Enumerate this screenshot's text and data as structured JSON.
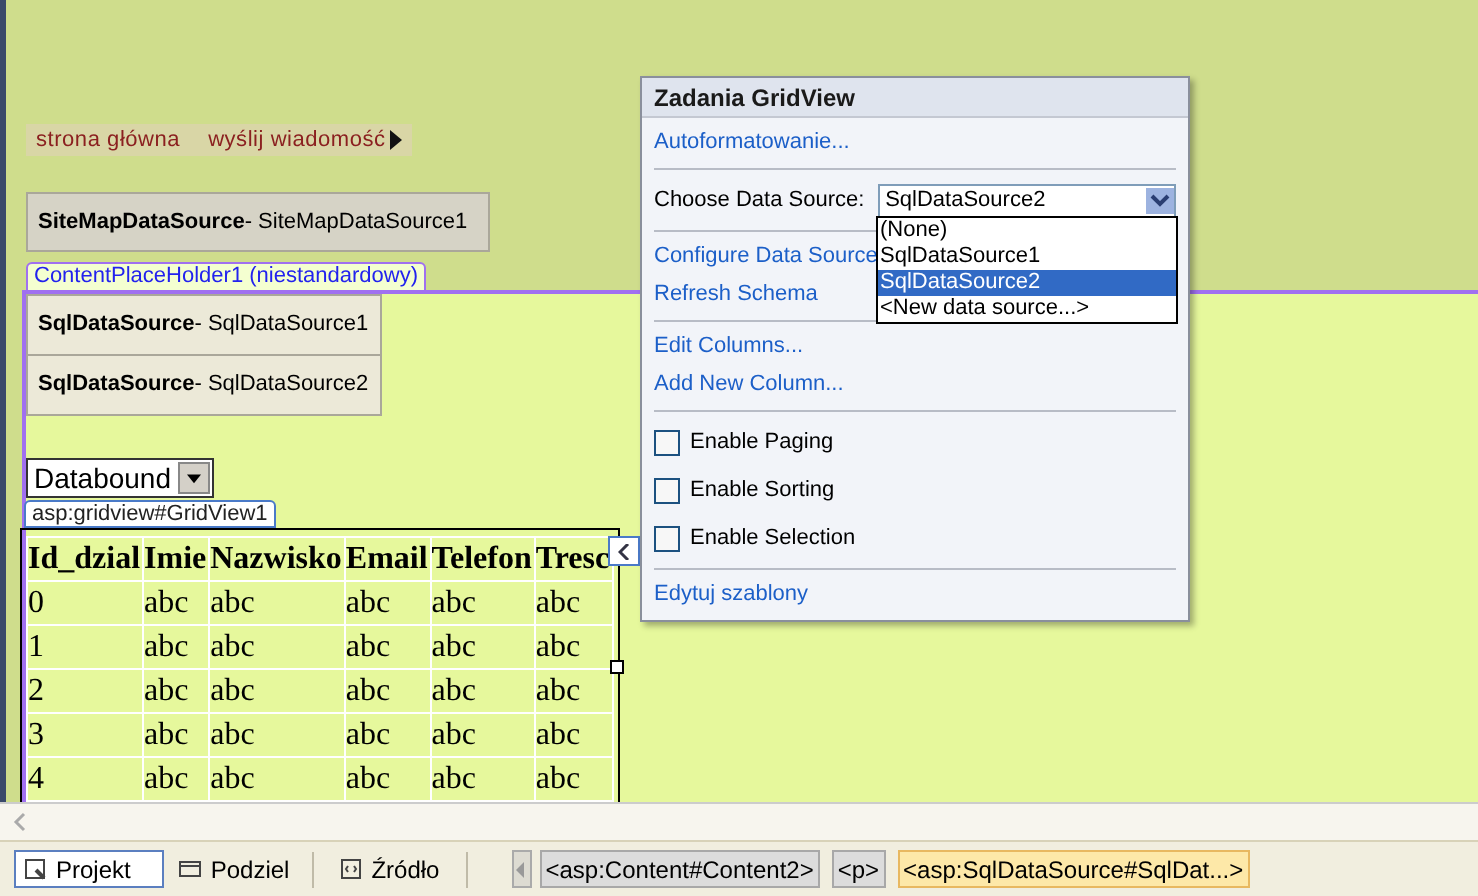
{
  "menu": {
    "items": [
      {
        "label": "strona główna"
      },
      {
        "label": "wyślij wiadomość"
      }
    ]
  },
  "sitemap_source": {
    "type": "SiteMapDataSource",
    "id": " - SiteMapDataSource1"
  },
  "content_placeholder": {
    "label": "ContentPlaceHolder1 (niestandardowy)"
  },
  "data_sources": [
    {
      "type": "SqlDataSource",
      "id": " - SqlDataSource1"
    },
    {
      "type": "SqlDataSource",
      "id": " - SqlDataSource2"
    }
  ],
  "databound_dropdown": {
    "value": "Databound"
  },
  "gridview": {
    "tag": "asp:gridview#GridView1",
    "columns": [
      "Id_dzial",
      "Imie",
      "Nazwisko",
      "Email",
      "Telefon",
      "Tresc"
    ],
    "rows": [
      [
        "0",
        "abc",
        "abc",
        "abc",
        "abc",
        "abc"
      ],
      [
        "1",
        "abc",
        "abc",
        "abc",
        "abc",
        "abc"
      ],
      [
        "2",
        "abc",
        "abc",
        "abc",
        "abc",
        "abc"
      ],
      [
        "3",
        "abc",
        "abc",
        "abc",
        "abc",
        "abc"
      ],
      [
        "4",
        "abc",
        "abc",
        "abc",
        "abc",
        "abc"
      ]
    ]
  },
  "tasks_panel": {
    "title": "Zadania GridView",
    "sections": [
      [
        {
          "kind": "link",
          "label": "Autoformatowanie..."
        }
      ],
      [
        {
          "kind": "select",
          "label": "Choose Data Source:",
          "value": "SqlDataSource2",
          "expanded": true,
          "options": [
            {
              "label": "(None)",
              "selected": false
            },
            {
              "label": "SqlDataSource1",
              "selected": false
            },
            {
              "label": "SqlDataSource2",
              "selected": true
            },
            {
              "label": "<New data source...>",
              "selected": false
            }
          ]
        }
      ],
      [
        {
          "kind": "link",
          "label": "Configure Data Source"
        },
        {
          "kind": "link",
          "label": "Refresh Schema"
        }
      ],
      [
        {
          "kind": "link",
          "label": "Edit Columns..."
        },
        {
          "kind": "link",
          "label": "Add New Column..."
        }
      ],
      [
        {
          "kind": "checkbox",
          "label": "Enable Paging",
          "checked": false
        },
        {
          "kind": "checkbox",
          "label": "Enable Sorting",
          "checked": false
        },
        {
          "kind": "checkbox",
          "label": "Enable Selection",
          "checked": false
        }
      ],
      [
        {
          "kind": "link",
          "label": "Edytuj szablony"
        }
      ]
    ]
  },
  "status_bar": {
    "view_tabs": [
      {
        "label": "Projekt",
        "selected": true
      },
      {
        "label": "Podziel",
        "selected": false
      },
      {
        "label": "Źródło",
        "selected": false
      }
    ],
    "breadcrumbs": [
      {
        "label": "<asp:Content#Content2>",
        "selected": false
      },
      {
        "label": "<p>",
        "selected": false
      },
      {
        "label": "<asp:SqlDataSource#SqlDat...>",
        "selected": true
      }
    ]
  }
}
